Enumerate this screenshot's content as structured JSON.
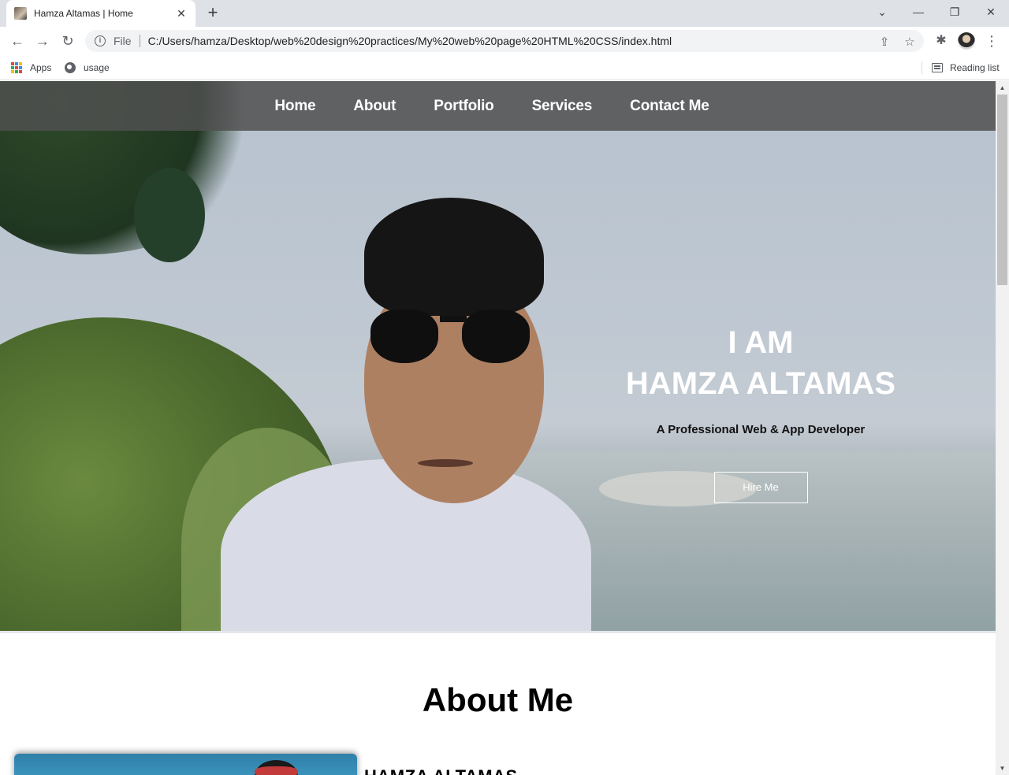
{
  "browser": {
    "tab_title": "Hamza Altamas | Home",
    "scheme": "File",
    "url": "C:/Users/hamza/Desktop/web%20design%20practices/My%20web%20page%20HTML%20CSS/index.html",
    "bookmarks": [
      {
        "label": "Apps",
        "icon": "apps-grid-icon"
      },
      {
        "label": "usage",
        "icon": "globe-icon"
      }
    ],
    "reading_list": "Reading list"
  },
  "page": {
    "nav": [
      "Home",
      "About",
      "Portfolio",
      "Services",
      "Contact Me"
    ],
    "hero": {
      "line1": "I AM",
      "line2": "HAMZA ALTAMAS",
      "subtitle": "A Professional Web & App Developer",
      "button": "Hire Me"
    },
    "about": {
      "title": "About Me",
      "name": "HAMZA ALTAMAS"
    }
  }
}
